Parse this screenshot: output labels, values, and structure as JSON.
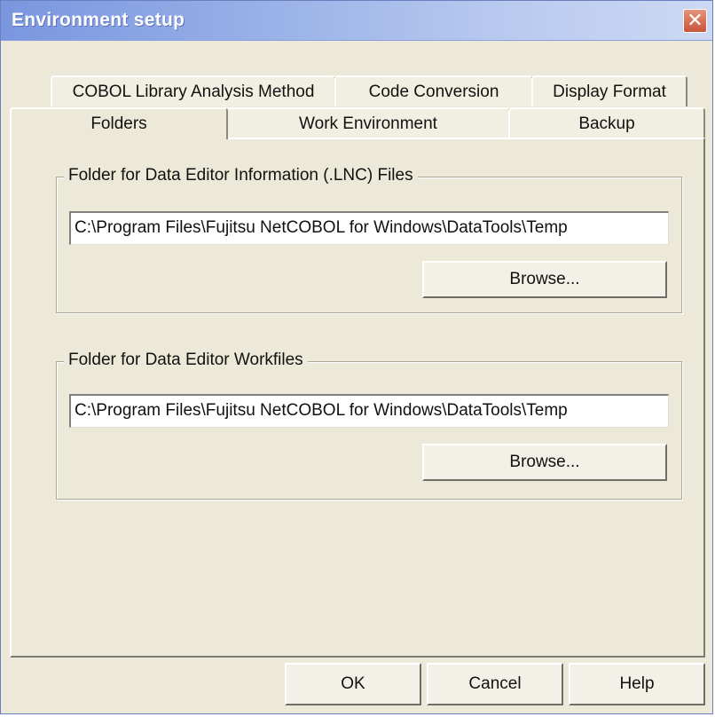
{
  "window": {
    "title": "Environment setup",
    "close_label": "✕"
  },
  "tabs": {
    "row_back": [
      "COBOL Library Analysis Method",
      "Code Conversion",
      "Display Format"
    ],
    "row_front": [
      "Folders",
      "Work Environment",
      "Backup"
    ],
    "active": "Folders"
  },
  "groups": [
    {
      "label": "Folder for Data Editor Information (.LNC) Files",
      "path": "C:\\Program Files\\Fujitsu NetCOBOL for Windows\\DataTools\\Temp",
      "browse_label": "Browse..."
    },
    {
      "label": "Folder for Data Editor Workfiles",
      "path": "C:\\Program Files\\Fujitsu NetCOBOL for Windows\\DataTools\\Temp",
      "browse_label": "Browse..."
    }
  ],
  "footer": {
    "ok_label": "OK",
    "cancel_label": "Cancel",
    "help_label": "Help"
  }
}
